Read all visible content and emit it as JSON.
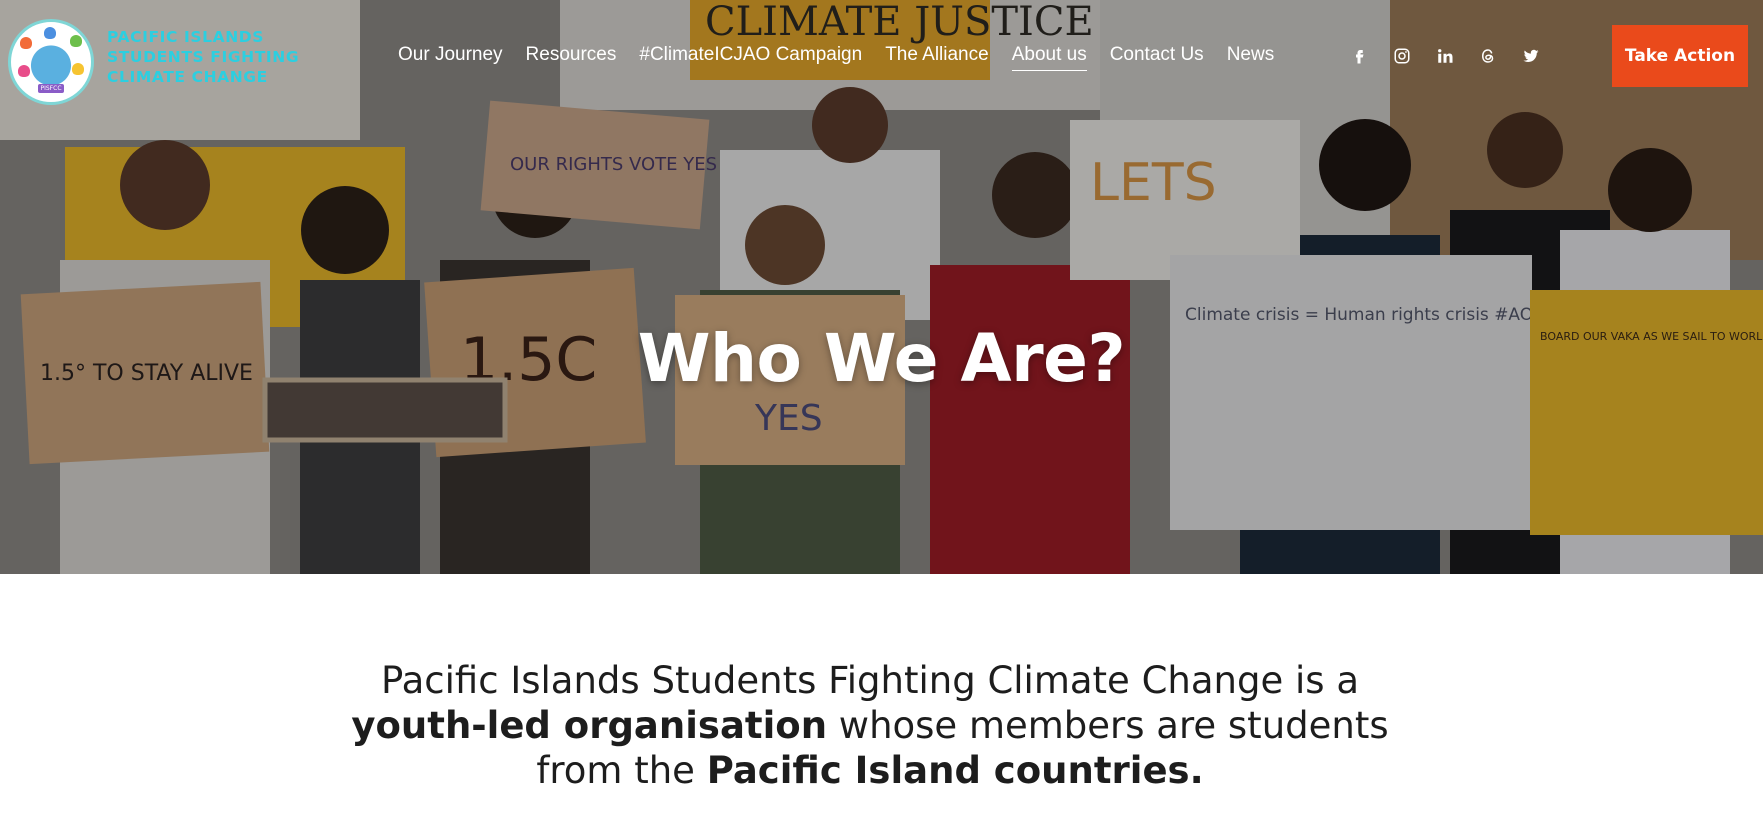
{
  "header": {
    "org_name_lines": [
      "PACIFIC ISLANDS",
      "STUDENTS FIGHTING",
      "CLIMATE CHANGE"
    ],
    "logo_badge": "PISFCC",
    "nav": [
      {
        "label": "Our Journey",
        "active": false
      },
      {
        "label": "Resources",
        "active": false
      },
      {
        "label": "#ClimateICJAO Campaign",
        "active": false
      },
      {
        "label": "The Alliance",
        "active": false
      },
      {
        "label": "About us",
        "active": true
      },
      {
        "label": "Contact Us",
        "active": false
      },
      {
        "label": "News",
        "active": false
      }
    ],
    "socials": [
      "facebook-icon",
      "instagram-icon",
      "linkedin-icon",
      "threads-icon",
      "twitter-icon"
    ],
    "cta_label": "Take Action"
  },
  "hero": {
    "title": "Who We Are?",
    "signs": {
      "s1": "1.5° TO STAY ALIVE",
      "s2": "1.5C",
      "s3": "Climate crisis = Human rights crisis #AOLetsgo",
      "s4": "BOARD OUR VAKA AS WE SAIL TO WORLDS HIGHEST COURT",
      "s5": "LETS",
      "s6": "CLIMATE JUSTICE",
      "s7": "OUR RIGHTS VOTE YES",
      "s8": "YES"
    }
  },
  "intro": {
    "p1": "Pacific Islands Students Fighting Climate Change is a ",
    "b1": "youth-led organisation",
    "p2": " whose members are students from the ",
    "b2": "Pacific Island countries."
  },
  "colors": {
    "accent": "#ea4a1b",
    "brand_teal": "#2ccfe0",
    "text": "#1d1d1d"
  }
}
